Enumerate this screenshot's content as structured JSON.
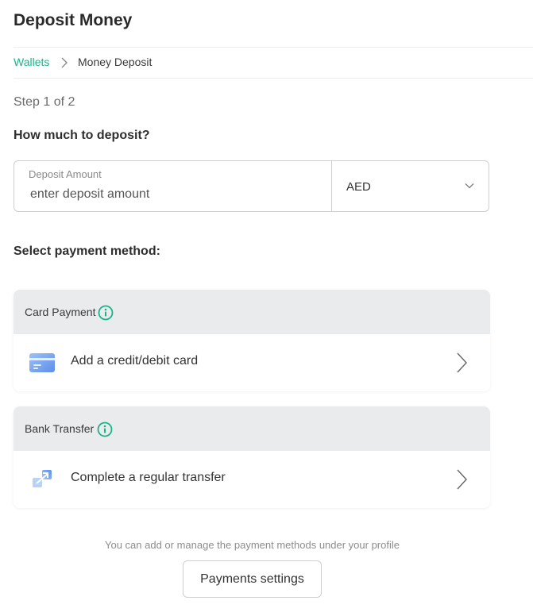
{
  "header": {
    "title": "Deposit Money"
  },
  "breadcrumb": {
    "parent": "Wallets",
    "current": "Money Deposit",
    "separator_icon": "chevron-right-icon"
  },
  "step": {
    "text": "Step 1 of 2"
  },
  "amount": {
    "question": "How much to deposit?",
    "label": "Deposit Amount",
    "placeholder": "enter deposit amount",
    "value": "",
    "currency": "AED",
    "currency_icon": "chevron-down-icon"
  },
  "payment": {
    "heading": "Select payment method:",
    "sections": [
      {
        "title": "Card Payment",
        "info_icon": "info-icon",
        "option_label": "Add a credit/debit card",
        "option_icon": "credit-card-icon"
      },
      {
        "title": "Bank Transfer",
        "info_icon": "info-icon",
        "option_label": "Complete a regular transfer",
        "option_icon": "transfer-arrows-icon"
      }
    ]
  },
  "footer": {
    "note": "You can add or manage the payment methods under your profile",
    "button_label": "Payments settings"
  },
  "colors": {
    "accent": "#19b38a",
    "section_header_bg": "#e9ebed",
    "border": "#cfcfcf",
    "icon_blue": "#5d8ee8"
  }
}
